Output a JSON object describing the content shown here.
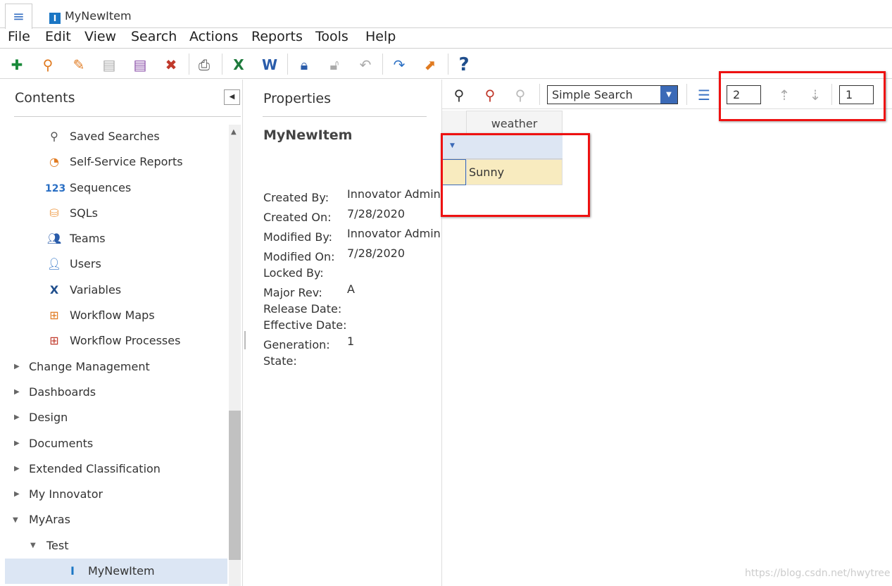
{
  "tab": {
    "title": "MyNewItem",
    "menu_icon": "hamburger-icon"
  },
  "menu": [
    "File",
    "Edit",
    "View",
    "Search",
    "Actions",
    "Reports",
    "Tools",
    "Help"
  ],
  "toolbar": {
    "icons": [
      "new-icon",
      "open-search-icon",
      "edit-icon",
      "save-icon",
      "save-as-icon",
      "delete-icon",
      "print-icon",
      "excel-icon",
      "word-icon",
      "lock-icon",
      "unlock-icon",
      "undo-icon",
      "promote-icon",
      "export-icon",
      "help-icon"
    ]
  },
  "contents": {
    "title": "Contents",
    "items": [
      {
        "label": "Saved Searches",
        "icon": "saved-searches-icon"
      },
      {
        "label": "Self-Service Reports",
        "icon": "reports-icon"
      },
      {
        "label": "Sequences",
        "icon": "123"
      },
      {
        "label": "SQLs",
        "icon": "database-icon"
      },
      {
        "label": "Teams",
        "icon": "teams-icon"
      },
      {
        "label": "Users",
        "icon": "user-icon"
      },
      {
        "label": "Variables",
        "icon": "X"
      },
      {
        "label": "Workflow Maps",
        "icon": "workflow-map-icon"
      },
      {
        "label": "Workflow Processes",
        "icon": "workflow-process-icon"
      }
    ],
    "groups": [
      "Change Management",
      "Dashboards",
      "Design",
      "Documents",
      "Extended Classification",
      "My Innovator",
      "MyAras"
    ],
    "sub": "Test",
    "selected": "MyNewItem"
  },
  "properties": {
    "title": "Properties",
    "item": "MyNewItem",
    "fields": [
      {
        "label": "Created By:",
        "value": "Innovator Admin"
      },
      {
        "label": "Created On:",
        "value": "7/28/2020"
      },
      {
        "label": "Modified By:",
        "value": "Innovator Admin"
      },
      {
        "label": "Modified On:",
        "value": "7/28/2020"
      },
      {
        "label": "Locked By:",
        "value": ""
      },
      {
        "label": "Major Rev:",
        "value": "A"
      },
      {
        "label": "Release Date:",
        "value": ""
      },
      {
        "label": "Effective Date:",
        "value": ""
      },
      {
        "label": "Generation:",
        "value": "1"
      },
      {
        "label": "State:",
        "value": ""
      }
    ]
  },
  "grid": {
    "search_mode": "Simple Search",
    "page_size": "2",
    "page": "1",
    "column": "weather",
    "rows": [
      [
        "Sunny"
      ]
    ]
  },
  "watermark": "https://blog.csdn.net/hwytree",
  "colors": {
    "accent": "#3b6ab7",
    "highlight": "#e11111",
    "row": "#f8ebbf"
  }
}
